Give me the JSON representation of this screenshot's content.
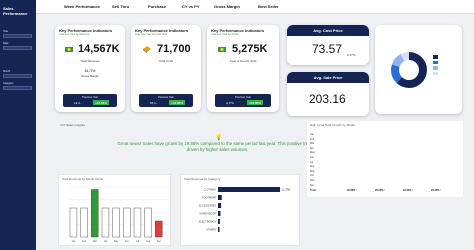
{
  "brand": {
    "logo_text": "Sales Performance"
  },
  "sidebar": {
    "filters": [
      {
        "label": "Year"
      },
      {
        "label": "Date"
      },
      {
        "label": "Month"
      },
      {
        "label": "Category"
      }
    ]
  },
  "tabs": [
    {
      "label": "Week Performance"
    },
    {
      "label": "Sell Thru"
    },
    {
      "label": "Purchase"
    },
    {
      "label": "CY vs PY"
    },
    {
      "label": "Gross Margin"
    },
    {
      "label": "Best Seller"
    }
  ],
  "kpis": [
    {
      "title": "Key Performance Indicators",
      "subtitle": "Year over Year by Revenue",
      "value": "14,567K",
      "name": "Total Revenue",
      "small_value": "63.77%",
      "small_name": "Gross Margin",
      "py_label": "Previous Year",
      "py_value": "12,4..",
      "py_pct": "+18.88%"
    },
    {
      "title": "Key Performance Indicators",
      "subtitle": "Year over Year by Units Sold",
      "value": "71,700",
      "name": "Total Units",
      "small_value": "",
      "small_name": "",
      "py_label": "Previous Year",
      "py_value": "65,1..",
      "py_pct": "+18.88%"
    },
    {
      "title": "Key Performance Indicators",
      "subtitle": "Year over Year by COGS",
      "value": "5,275K",
      "name": "Cost of Good's Sold",
      "small_value": "",
      "small_name": "",
      "py_label": "Previous Year",
      "py_value": "4,774..",
      "py_pct": "+18.88%"
    }
  ],
  "avg_cost": {
    "title": "Avg. Cost Price",
    "value": "73.57",
    "pct": "0.37%"
  },
  "avg_sale": {
    "title": "Avg. Sale Price",
    "value": "203.16"
  },
  "donut": {
    "legend": [
      "",
      "",
      "",
      ""
    ],
    "colors": [
      "#142554",
      "#2b6cd9",
      "#8fb3ee",
      "#d5e1f8"
    ],
    "values": [
      0.62,
      0.18,
      0.12,
      0.08
    ]
  },
  "insights": {
    "title": "YoY Sales Insights",
    "text": "Great news! Sales have grown by 19.58% compared to the same period last year. This positive trend is driven by higher sales volumes."
  },
  "month_chart": {
    "title": "Total Revenue by Month Name",
    "months": [
      "Jan",
      "Feb",
      "Mar",
      "Apr",
      "May",
      "Jun",
      "Jul",
      "Aug",
      "Sep"
    ],
    "values": [
      0.58,
      0.58,
      0.95,
      0.58,
      0.58,
      0.58,
      0.58,
      0.58,
      0.32
    ],
    "colors": [
      "#ffffff",
      "#ffffff",
      "#2e9b3a",
      "#ffffff",
      "#ffffff",
      "#ffffff",
      "#ffffff",
      "#ffffff",
      "#e23b3b"
    ]
  },
  "category_chart": {
    "title": "Total Revenue by Category",
    "categories": [
      "CLOTHING",
      "FOOTWEAR",
      "ACCESSORIES",
      "HOME DECOR",
      "ELECTRONICS",
      "OTHERS"
    ],
    "values": [
      1.0,
      0.06,
      0.05,
      0.04,
      0.03,
      0.02
    ],
    "value_labels": [
      "11,756K",
      "",
      "",
      "",
      "",
      ""
    ]
  },
  "table": {
    "title": "High Level Total Growth by Month",
    "headers": [
      "",
      "",
      "",
      "",
      "",
      ""
    ],
    "rows": [
      {
        "label": "Jan",
        "c1": "",
        "c2": "",
        "c3": "",
        "c4": ""
      },
      {
        "label": "Feb",
        "c1": "",
        "c2": "",
        "c3": "",
        "c4": ""
      },
      {
        "label": "Mar",
        "c1": "",
        "c2": "",
        "c3": "",
        "c4": ""
      },
      {
        "label": "Apr",
        "c1": "",
        "c2": "",
        "c3": "",
        "c4": ""
      },
      {
        "label": "May",
        "c1": "",
        "c2": "",
        "c3": "",
        "c4": ""
      },
      {
        "label": "Jun",
        "c1": "",
        "c2": "",
        "c3": "",
        "c4": ""
      },
      {
        "label": "Jul",
        "c1": "",
        "c2": "",
        "c3": "",
        "c4": ""
      },
      {
        "label": "Aug",
        "c1": "",
        "c2": "",
        "c3": "",
        "c4": ""
      },
      {
        "label": "Sep",
        "c1": "",
        "c2": "",
        "c3": "",
        "c4": ""
      },
      {
        "label": "Oct",
        "c1": "",
        "c2": "",
        "c3": "",
        "c4": ""
      },
      {
        "label": "Nov",
        "c1": "",
        "c2": "",
        "c3": "",
        "c4": ""
      },
      {
        "label": "Dec",
        "c1": "",
        "c2": "",
        "c3": "",
        "c4": ""
      }
    ],
    "total": {
      "label": "Total",
      "c1": "49.86% ↑",
      "c2": "20.03% ↑",
      "c3": "19.94% ↑",
      "c4": "23.46% ↑"
    }
  }
}
